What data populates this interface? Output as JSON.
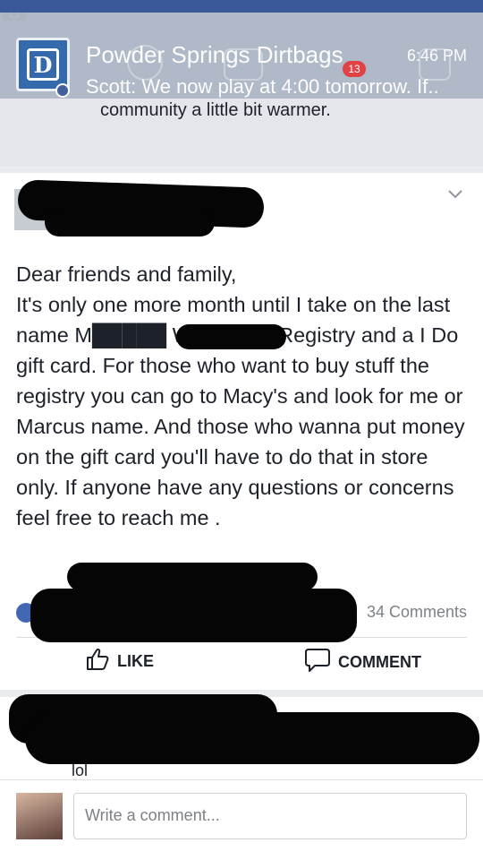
{
  "notification": {
    "title": "Powder Springs Dirtbags",
    "time": "6:46 PM",
    "body": "Scott: We now play at 4:00 tomorrow. If..",
    "badge": "13"
  },
  "previous_post": {
    "text": "community a little bit warmer."
  },
  "post": {
    "text": "Dear friends and family,\nIt's only one more month until I take on the last name M█████ We have a Registry and a I Do gift card. For those who want to buy stuff the registry you can go to Macy's and look for me or Marcus name. And those who wanna put money on the gift card you'll have to do that in store only. If anyone have any questions or concerns feel free to reach me .",
    "comments_count": "34 Comments",
    "like_label": "LIKE",
    "comment_label": "COMMENT"
  },
  "comment": {
    "tail": "lol"
  },
  "composer": {
    "placeholder": "Write a comment..."
  },
  "colors": {
    "facebook_blue": "#3b5998",
    "card": "#ffffff",
    "feed_bg": "#e9ebee"
  }
}
